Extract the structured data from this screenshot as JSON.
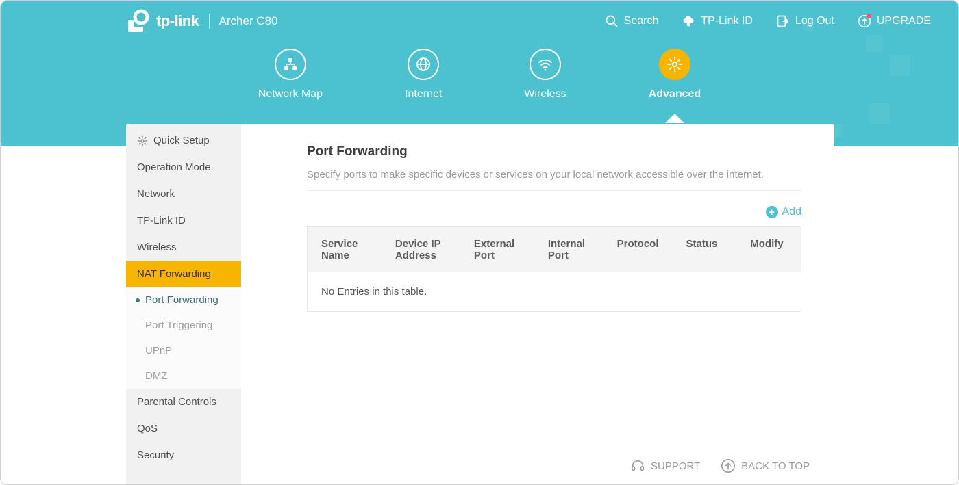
{
  "brand": {
    "name": "tp-link",
    "model": "Archer C80"
  },
  "topLinks": {
    "search": "Search",
    "tplink_id": "TP-Link ID",
    "logout": "Log Out",
    "upgrade": "UPGRADE"
  },
  "navTabs": {
    "items": [
      {
        "label": "Network Map"
      },
      {
        "label": "Internet"
      },
      {
        "label": "Wireless"
      },
      {
        "label": "Advanced"
      }
    ],
    "activeIndex": 3
  },
  "sidebar": {
    "items": [
      {
        "label": "Quick Setup"
      },
      {
        "label": "Operation Mode"
      },
      {
        "label": "Network"
      },
      {
        "label": "TP-Link ID"
      },
      {
        "label": "Wireless"
      },
      {
        "label": "NAT Forwarding"
      },
      {
        "label": "Parental Controls"
      },
      {
        "label": "QoS"
      },
      {
        "label": "Security"
      }
    ],
    "activeIndex": 5,
    "subItems": [
      {
        "label": "Port Forwarding"
      },
      {
        "label": "Port Triggering"
      },
      {
        "label": "UPnP"
      },
      {
        "label": "DMZ"
      }
    ],
    "subActiveIndex": 0
  },
  "content": {
    "title": "Port Forwarding",
    "description": "Specify ports to make specific devices or services on your local network accessible over the internet.",
    "addLabel": "Add",
    "table": {
      "headers": [
        "Service Name",
        "Device IP Address",
        "External Port",
        "Internal Port",
        "Protocol",
        "Status",
        "Modify"
      ],
      "emptyText": "No Entries in this table."
    }
  },
  "footer": {
    "support": "SUPPORT",
    "backToTop": "BACK TO TOP"
  }
}
